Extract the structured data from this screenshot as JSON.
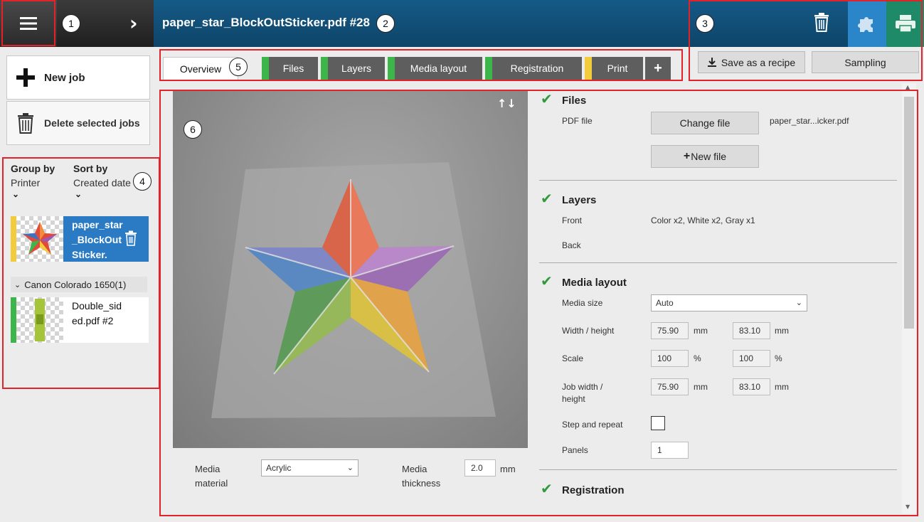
{
  "header": {
    "job_title": "paper_star_BlockOutSticker.pdf #28",
    "actions": {
      "save_recipe": "Save as a recipe",
      "sampling": "Sampling"
    }
  },
  "sidebar": {
    "new_job": "New job",
    "delete_jobs": "Delete selected jobs",
    "group_by_label": "Group by",
    "group_by_value": "Printer",
    "sort_by_label": "Sort by",
    "sort_by_value": "Created date",
    "jobs": [
      {
        "name": "paper_star_BlockOutSticker.",
        "stripe": "#f2cc3a",
        "selected": true
      },
      {
        "name": "Double_sided.pdf #2",
        "stripe": "#3cb54a",
        "selected": false
      }
    ],
    "printer_group": "Canon Colorado 1650(1)"
  },
  "tabs": [
    {
      "label": "Overview",
      "active": true,
      "color": ""
    },
    {
      "label": "Files",
      "color": "#3cb54a"
    },
    {
      "label": "Layers",
      "color": "#3cb54a"
    },
    {
      "label": "Media layout",
      "color": "#3cb54a"
    },
    {
      "label": "Registration",
      "color": "#3cb54a"
    },
    {
      "label": "Print",
      "color": "#f2cc3a"
    },
    {
      "label": "+",
      "color": ""
    }
  ],
  "preview": {
    "media_material_label": "Media material",
    "media_material_value": "Acrylic",
    "media_thickness_label": "Media thickness",
    "media_thickness_value": "2.0",
    "media_thickness_unit": "mm"
  },
  "details": {
    "files": {
      "title": "Files",
      "pdf_label": "PDF file",
      "change_button": "Change file",
      "new_button": "New file",
      "file_name": "paper_star...icker.pdf"
    },
    "layers": {
      "title": "Layers",
      "front_label": "Front",
      "front_value": "Color x2, White x2, Gray x1",
      "back_label": "Back"
    },
    "media_layout": {
      "title": "Media layout",
      "media_size_label": "Media size",
      "media_size_value": "Auto",
      "width_height_label": "Width / height",
      "width": "75.90",
      "height": "83.10",
      "scale_label": "Scale",
      "scale_x": "100",
      "scale_y": "100",
      "job_wh_label": "Job width / height",
      "job_width": "75.90",
      "job_height": "83.10",
      "step_repeat_label": "Step and repeat",
      "panels_label": "Panels",
      "panels_value": "1",
      "unit_mm": "mm",
      "unit_pct": "%"
    },
    "registration": {
      "title": "Registration"
    }
  },
  "callouts": [
    "1",
    "2",
    "3",
    "4",
    "5",
    "6"
  ],
  "colors": {
    "header_blue": "#155a87",
    "selected_blue": "#2b7bc4",
    "green": "#3cb54a",
    "yellow": "#f2cc3a",
    "annotation_red": "#e2232a"
  }
}
